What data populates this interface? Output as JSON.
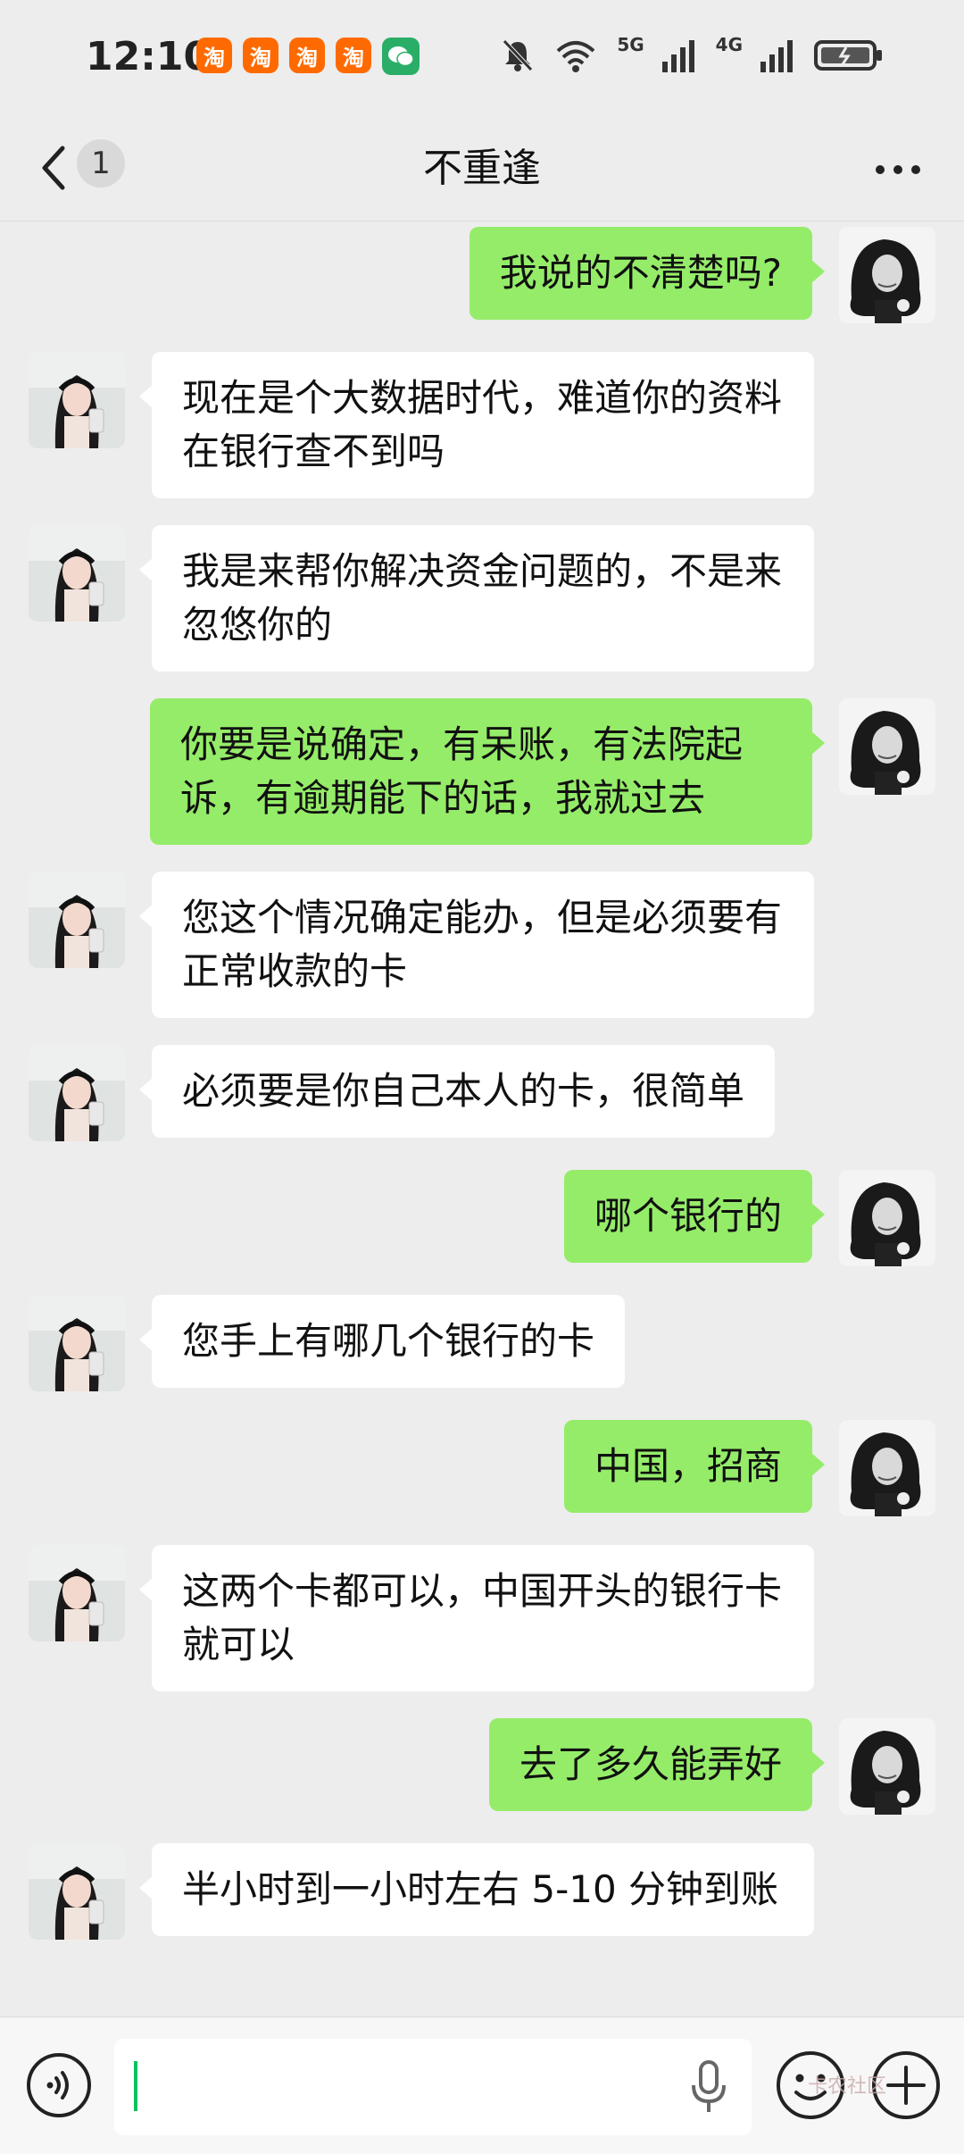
{
  "status_bar": {
    "time": "12:10",
    "taobao_glyph": "淘",
    "signal_5g": "5G",
    "signal_4g": "4G",
    "icons": [
      "taobao-icon",
      "taobao-icon",
      "taobao-icon",
      "taobao-icon",
      "wechat-icon",
      "mute-bell-icon",
      "wifi-icon",
      "signal-5g-icon",
      "signal-4g-icon",
      "battery-charging-icon"
    ]
  },
  "header": {
    "back_icon": "chevron-left-icon",
    "unread_count": "1",
    "title": "不重逢",
    "more_icon": "more-dots-icon"
  },
  "messages": [
    {
      "side": "out",
      "text": "我说的不清楚吗?"
    },
    {
      "side": "in",
      "text": "现在是个大数据时代，难道你的资料在银行查不到吗"
    },
    {
      "side": "in",
      "text": "我是来帮你解决资金问题的，不是来忽悠你的"
    },
    {
      "side": "out",
      "text": "你要是说确定，有呆账，有法院起诉，有逾期能下的话，我就过去"
    },
    {
      "side": "in",
      "text": "您这个情况确定能办，但是必须要有正常收款的卡"
    },
    {
      "side": "in",
      "text": "必须要是你自己本人的卡，很简单"
    },
    {
      "side": "out",
      "text": "哪个银行的"
    },
    {
      "side": "in",
      "text": "您手上有哪几个银行的卡"
    },
    {
      "side": "out",
      "text": "中国，招商"
    },
    {
      "side": "in",
      "text": "这两个卡都可以，中国开头的银行卡就可以"
    },
    {
      "side": "out",
      "text": "去了多久能弄好"
    },
    {
      "side": "in",
      "text": "半小时到一小时左右 5-10 分钟到账"
    }
  ],
  "input_bar": {
    "voice_icon": "voice-icon",
    "mic_icon": "microphone-icon",
    "emoji_icon": "emoji-icon",
    "plus_icon": "plus-icon",
    "watermark": "卡农社区"
  },
  "colors": {
    "background": "#ededed",
    "outgoing_bubble": "#95ec69",
    "incoming_bubble": "#ffffff",
    "accent": "#07c160"
  }
}
